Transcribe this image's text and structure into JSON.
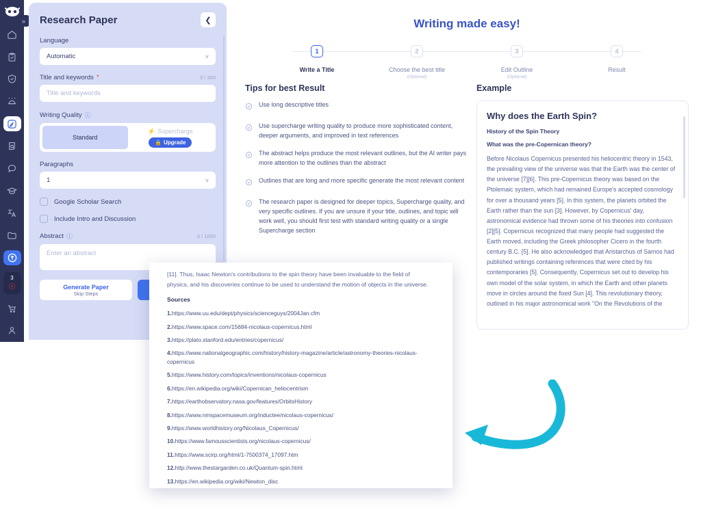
{
  "rail": {
    "logo_icon": "robot-logo-icon",
    "expand_label": "»",
    "items": [
      {
        "icon": "home-icon",
        "state": "default"
      },
      {
        "icon": "clipboard-check-icon",
        "state": "default"
      },
      {
        "icon": "shield-check-icon",
        "state": "default"
      },
      {
        "icon": "alarm-icon",
        "state": "default"
      },
      {
        "icon": "edit-pencil-icon",
        "state": "active-white"
      },
      {
        "icon": "search-document-icon",
        "state": "default"
      },
      {
        "icon": "chat-bubble-icon",
        "state": "default"
      },
      {
        "icon": "graduation-cap-icon",
        "state": "default"
      },
      {
        "icon": "translate-icon",
        "state": "default"
      },
      {
        "icon": "folder-icon",
        "state": "default"
      },
      {
        "icon": "upload-circle-icon",
        "state": "active-blue"
      }
    ],
    "badge": {
      "count": "3",
      "icon": "coin-icon"
    },
    "footer": [
      {
        "icon": "cart-icon"
      },
      {
        "icon": "user-icon"
      }
    ]
  },
  "panel": {
    "title": "Research Paper",
    "collapse_icon": "chevron-left-icon",
    "language": {
      "label": "Language",
      "value": "Automatic",
      "chevron": "chevron-down-icon"
    },
    "title_keywords": {
      "label": "Title and keywords",
      "required_mark": "*",
      "counter": "0 / 300",
      "placeholder": "Title and keywords"
    },
    "writing_quality": {
      "label": "Writing Quality",
      "info_icon": "info-icon",
      "standard_label": "Standard",
      "supercharge_label": "Supercharge",
      "supercharge_icon": "bolt-icon",
      "upgrade_label": "Upgrade",
      "upgrade_icon": "lock-icon"
    },
    "paragraphs": {
      "label": "Paragraphs",
      "value": "1",
      "chevron": "chevron-down-icon"
    },
    "checkboxes": [
      {
        "label": "Google Scholar Search",
        "checked": false
      },
      {
        "label": "Include Intro and Discussion",
        "checked": false
      }
    ],
    "abstract": {
      "label": "Abstract",
      "info_icon": "info-icon",
      "counter": "0 / 1000",
      "placeholder": "Enter an abstract"
    },
    "generate": {
      "primary": "Generate Paper",
      "secondary": "Skip Steps"
    }
  },
  "main": {
    "title": "Writing made easy!",
    "steps": [
      {
        "num": "1",
        "label": "Write a Title",
        "optional": "",
        "active": true
      },
      {
        "num": "2",
        "label": "Choose the best title",
        "optional": "(Optional)",
        "active": false
      },
      {
        "num": "3",
        "label": "Edit Outline",
        "optional": "(Optional)",
        "active": false
      },
      {
        "num": "4",
        "label": "Result",
        "optional": "",
        "active": false
      }
    ],
    "tips": {
      "title": "Tips for best Result",
      "check_icon": "circle-check-icon",
      "items": [
        "Use long descriptive titles",
        "Use supercharge writing quality to produce more sophisticated content, deeper arguments, and improved in text references",
        "The abstract helps produce the most relevant outlines, but the AI writer pays more attention to the outlines than the abstract",
        "Outlines that are long and more specific generate the most relevant content",
        "The research paper is designed for deeper topics, Supercharge quality, and very specific outlines. If you are unsure if your title, outlines, and topic will work well, you should first test with standard writing quality or a single Supercharge section"
      ]
    },
    "example": {
      "title": "Example",
      "heading": "Why does the Earth Spin?",
      "sub1": "History of the Spin Theory",
      "sub2": "What was the pre-Copernican theory?",
      "body": "Before Nicolaus Copernicus presented his heliocentric theory in 1543, the prevailing view of the universe was that the Earth was the center of the universe [7][6]. This pre-Copernicus theory was based on the Ptolemaic system, which had remained Europe's accepted cosmology for over a thousand years [5]. In this system, the planets orbited the Earth rather than the sun [3]. However, by Copernicus' day, astronomical evidence had thrown some of his theories into confusion [2][5]. Copernicus recognized that many people had suggested the Earth moved, including the Greek philosopher Cicero in the fourth century B.C. [5]. He also acknowledged that Aristarchus of Samos had published writings containing references that were cited by his contemporaries [5]. Consequently, Copernicus set out to develop his own model of the solar system, in which the Earth and other planets move in circles around the fixed Sun [4]. This revolutionary theory, outlined in his major astronomical work \"On the Revolutions of the"
    }
  },
  "popup": {
    "clipped_line": "[11]. Thus, Isaac Newton's contributions to the spin theory have been invaluable to the field of",
    "intro": "physics, and his discoveries continue to be used to understand the motion of objects in the universe.",
    "sources_title": "Sources",
    "sources": [
      {
        "n": "1.",
        "url": "https://www.uu.edu/dept/physics/scienceguys/2004Jan.cfm"
      },
      {
        "n": "2.",
        "url": "https://www.space.com/15684-nicolaus-copernicus.html"
      },
      {
        "n": "3.",
        "url": "https://plato.stanford.edu/entries/copernicus/"
      },
      {
        "n": "4.",
        "url": "https://www.nationalgeographic.com/history/history-magazine/article/astronomy-theories-nicolaus-copernicus"
      },
      {
        "n": "5.",
        "url": "https://www.history.com/topics/inventions/nicolaus-copernicus"
      },
      {
        "n": "6.",
        "url": "https://en.wikipedia.org/wiki/Copernican_heliocentrism"
      },
      {
        "n": "7.",
        "url": "https://earthobservatory.nasa.gov/features/OrbitsHistory"
      },
      {
        "n": "8.",
        "url": "https://www.nmspacemuseum.org/inductee/nicolaus-copernicus/"
      },
      {
        "n": "9.",
        "url": "https://www.worldhistory.org/Nicolaus_Copernicus/"
      },
      {
        "n": "10.",
        "url": "https://www.famousscientists.org/nicolaus-copernicus/"
      },
      {
        "n": "11.",
        "url": "https://www.scirp.org/html/1-7500374_17097.htm"
      },
      {
        "n": "12.",
        "url": "http://www.thestargarden.co.uk/Quantum-spin.html"
      },
      {
        "n": "13.",
        "url": "https://en.wikipedia.org/wiki/Newton_disc"
      }
    ]
  },
  "annotation": {
    "arrow_icon": "curved-arrow-left-icon",
    "color": "#1ab8d8"
  },
  "colors": {
    "rail_bg": "#2e3459",
    "panel_bg": "#d6dcf5",
    "accent_blue": "#4074f0",
    "title_blue": "#3a53c5",
    "arrow_cyan": "#1ab8d8"
  }
}
